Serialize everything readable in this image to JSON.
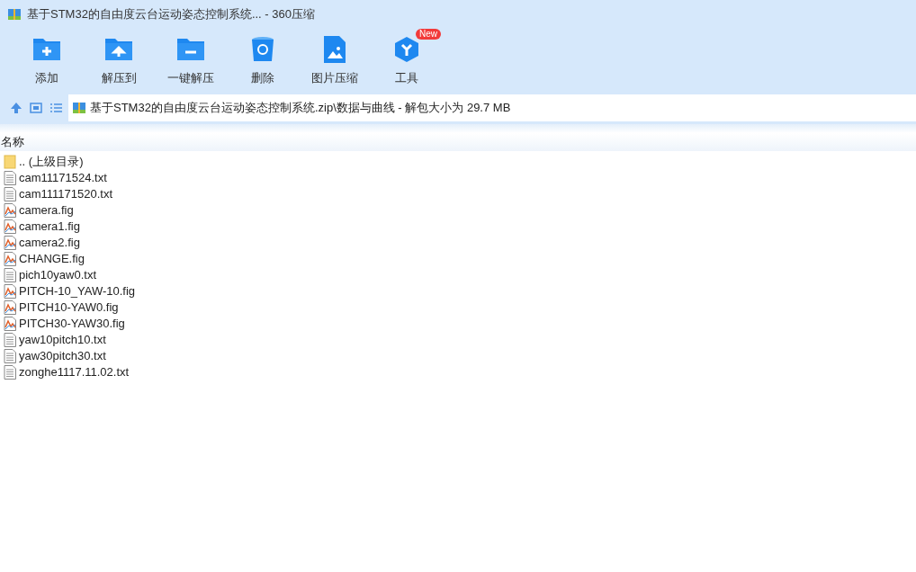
{
  "window": {
    "title": "基于STM32的自由度云台运动姿态控制系统... - 360压缩"
  },
  "toolbar": [
    {
      "kind": "add",
      "label": "添加"
    },
    {
      "kind": "extract",
      "label": "解压到"
    },
    {
      "kind": "oneclick",
      "label": "一键解压"
    },
    {
      "kind": "delete",
      "label": "删除"
    },
    {
      "kind": "image",
      "label": "图片压缩"
    },
    {
      "kind": "tools",
      "label": "工具",
      "badge": "New"
    }
  ],
  "address": {
    "path": "基于STM32的自由度云台运动姿态控制系统.zip\\数据与曲线 - 解包大小为 29.7 MB"
  },
  "table": {
    "columns": [
      "名称"
    ],
    "rows": [
      {
        "kind": "folder",
        "name": ".. (上级目录)"
      },
      {
        "kind": "text",
        "name": "cam11171524.txt"
      },
      {
        "kind": "text",
        "name": "cam111171520.txt"
      },
      {
        "kind": "figure",
        "name": "camera.fig"
      },
      {
        "kind": "figure",
        "name": "camera1.fig"
      },
      {
        "kind": "figure",
        "name": "camera2.fig"
      },
      {
        "kind": "figure",
        "name": "CHANGE.fig"
      },
      {
        "kind": "text",
        "name": "pich10yaw0.txt"
      },
      {
        "kind": "figure",
        "name": "PITCH-10_YAW-10.fig"
      },
      {
        "kind": "figure",
        "name": "PITCH10-YAW0.fig"
      },
      {
        "kind": "figure",
        "name": "PITCH30-YAW30.fig"
      },
      {
        "kind": "text",
        "name": "yaw10pitch10.txt"
      },
      {
        "kind": "text",
        "name": "yaw30pitch30.txt"
      },
      {
        "kind": "text",
        "name": "zonghe1117.11.02.txt"
      }
    ]
  }
}
